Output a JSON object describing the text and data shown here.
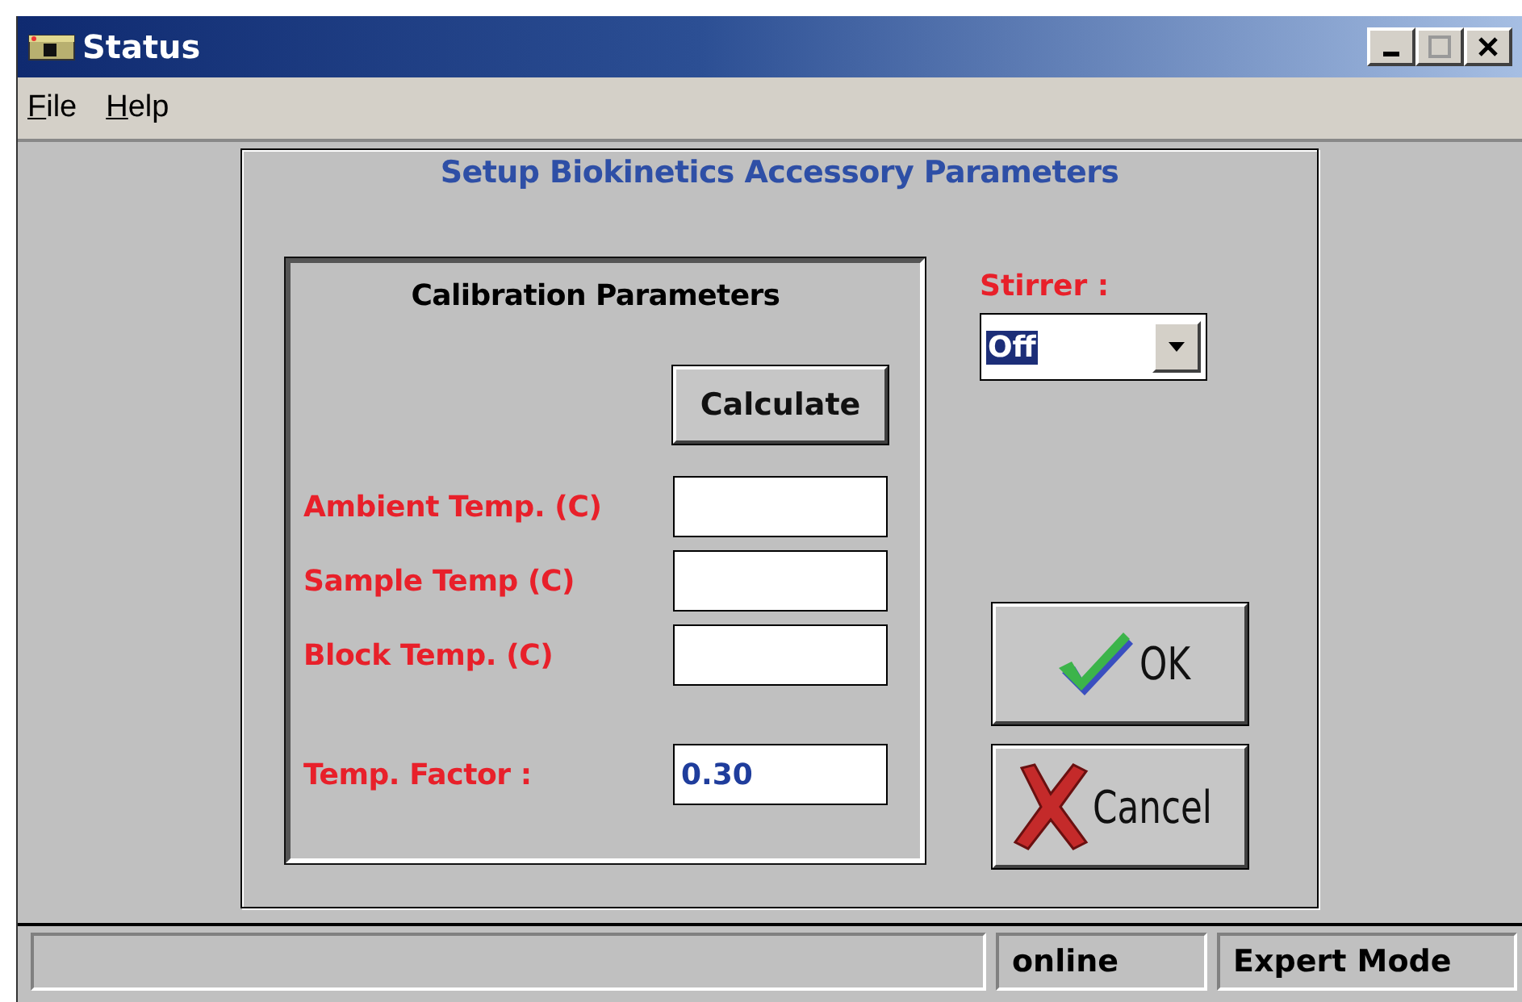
{
  "window": {
    "title": "Status"
  },
  "menu": [
    {
      "label": "File"
    },
    {
      "label": "Help"
    }
  ],
  "dialog": {
    "title": "Setup Biokinetics Accessory Parameters",
    "calibration": {
      "title": "Calibration Parameters",
      "button": "Calculate",
      "fields": [
        {
          "label": "Ambient Temp. (C)"
        },
        {
          "label": "Sample Temp (C)"
        },
        {
          "label": "Block Temp. (C)"
        },
        {
          "label": "Temp. Factor :",
          "value": "0.30"
        }
      ]
    },
    "stirrer": {
      "label": "Stirrer :",
      "value": "Off"
    },
    "buttons": [
      {
        "label": "OK",
        "kind": "ok"
      },
      {
        "label": "Cancel",
        "kind": "cancel"
      }
    ]
  },
  "status_bar": [
    "online",
    "Expert Mode"
  ]
}
